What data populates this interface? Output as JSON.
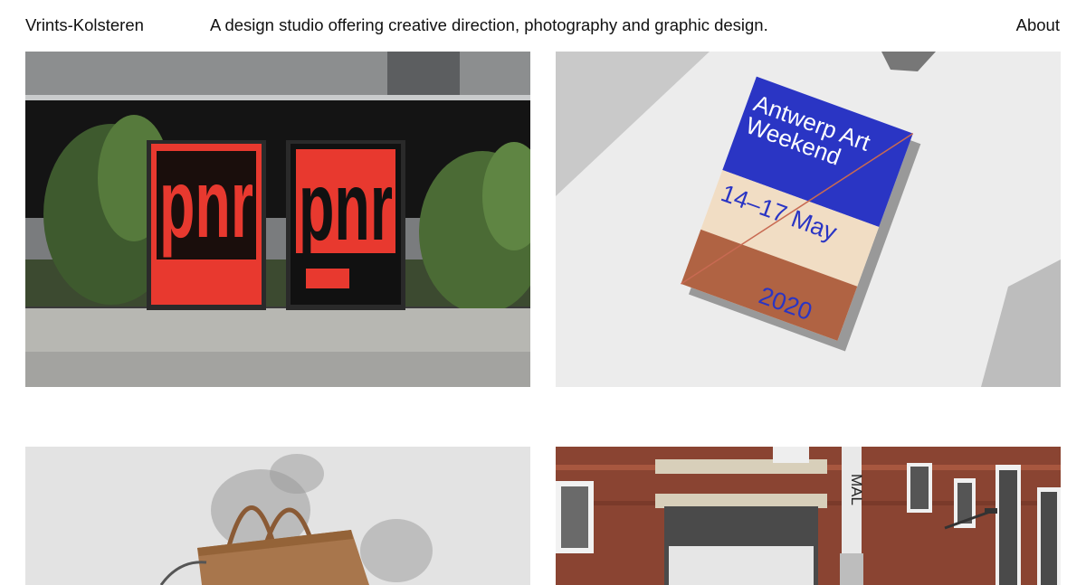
{
  "header": {
    "brand": "Vrints-Kolsteren",
    "tagline": "A design studio offering creative direction, photography and graphic design.",
    "about_label": "About"
  },
  "projects": [
    {
      "poster_text_1": "pnr",
      "poster_text_2": "pnr"
    },
    {
      "title_line_1": "Antwerp Art",
      "title_line_2": "Weekend",
      "dates": "14–17 May",
      "year": "2020"
    },
    {},
    {
      "sign_text": "MAL"
    }
  ],
  "colors": {
    "poster_red": "#e8392f",
    "book_blue": "#2a35c4",
    "book_rust": "#b06343",
    "book_cream": "#f1ddc4",
    "brick": "#8a4432"
  }
}
